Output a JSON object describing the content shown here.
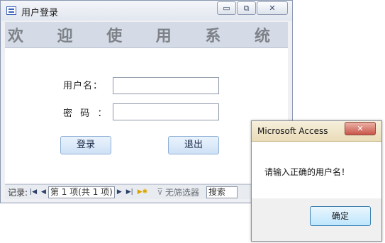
{
  "window": {
    "title": "用户登录",
    "minimize_glyph": "▭",
    "restore_glyph": "⧉",
    "close_glyph": "✕"
  },
  "banner": {
    "chars": [
      "欢",
      "迎",
      "使",
      "用",
      "系",
      "统"
    ]
  },
  "form": {
    "username_label": "用户名：",
    "username_value": "",
    "password_label": "密  码  ：",
    "password_value": "",
    "login_label": "登录",
    "exit_label": "退出"
  },
  "nav": {
    "record_label": "记录:",
    "first_icon": "first-record-icon",
    "prev_icon": "previous-record-icon",
    "record_value": "第 1 项(共 1 项)",
    "next_icon": "next-record-icon",
    "last_icon": "last-record-icon",
    "new_icon": "new-record-icon",
    "filter_icon": "no-filter-icon",
    "filter_label": "无筛选器",
    "search_label": "搜索"
  },
  "dialog": {
    "title": "Microsoft Access",
    "close_glyph": "✕",
    "message": "请输入正确的用户名！",
    "ok_label": "确定"
  }
}
